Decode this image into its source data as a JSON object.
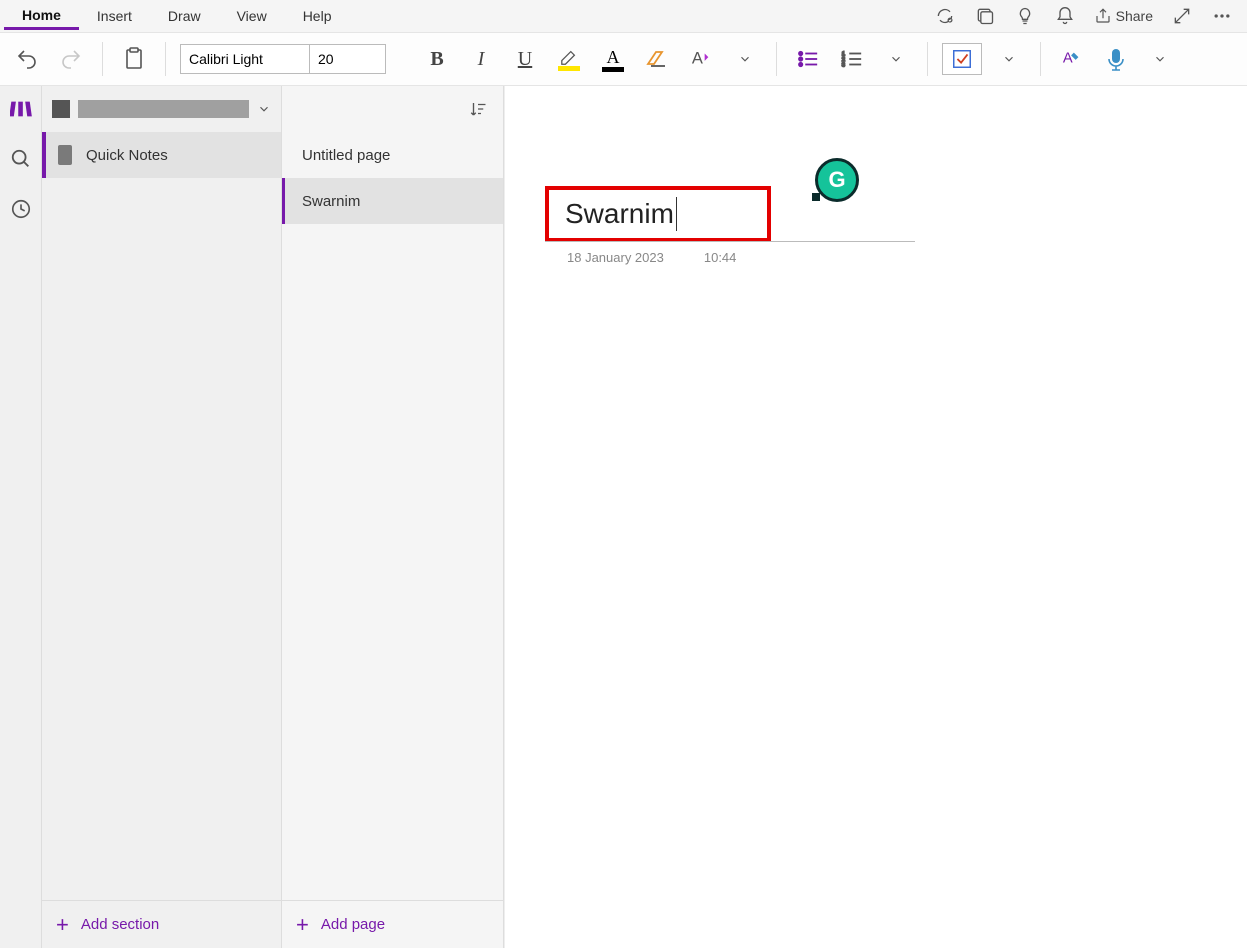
{
  "menu": {
    "tabs": [
      "Home",
      "Insert",
      "Draw",
      "View",
      "Help"
    ],
    "active": 0,
    "share_label": "Share"
  },
  "ribbon": {
    "font_name": "Calibri Light",
    "font_size": "20"
  },
  "sidebar": {
    "sections": [
      {
        "label": "Quick Notes"
      }
    ],
    "add_section_label": "Add section"
  },
  "pages": {
    "items": [
      {
        "label": "Untitled page",
        "selected": false
      },
      {
        "label": "Swarnim",
        "selected": true
      }
    ],
    "add_page_label": "Add page"
  },
  "note": {
    "title": "Swarnim",
    "date": "18 January 2023",
    "time": "10:44"
  }
}
